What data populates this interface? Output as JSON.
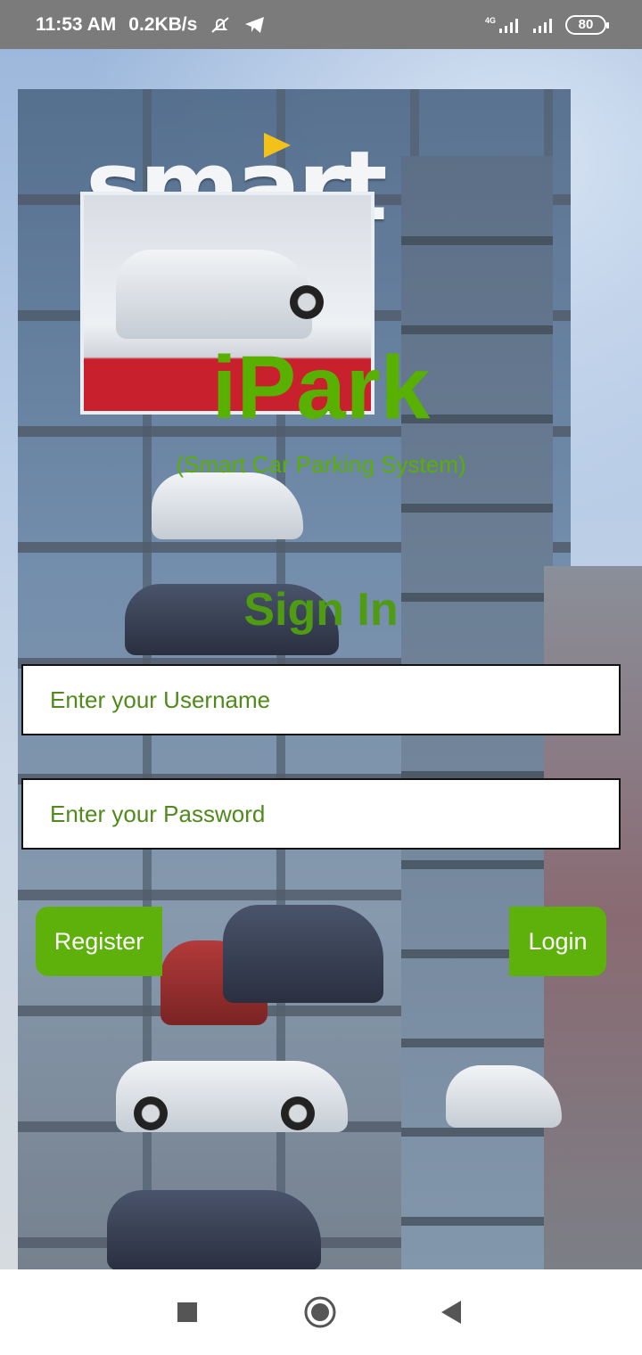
{
  "status_bar": {
    "time": "11:53 AM",
    "network_speed": "0.2KB/s",
    "network_type": "4G",
    "battery": "80",
    "icons": [
      "mute-alarm-icon",
      "telegram-icon",
      "signal-icon",
      "signal-icon",
      "battery-icon"
    ]
  },
  "app": {
    "title": "iPark",
    "subtitle": "(Smart Car Parking System)",
    "heading": "Sign In"
  },
  "form": {
    "username_placeholder": "Enter your Username",
    "username_value": "",
    "password_placeholder": "Enter your Password",
    "password_value": ""
  },
  "buttons": {
    "register": "Register",
    "login": "Login"
  },
  "background": {
    "brand_text": "smart"
  },
  "nav_bar": {
    "icons": [
      "recents-icon",
      "home-icon",
      "back-icon"
    ]
  },
  "colors": {
    "accent": "#5eb10a",
    "title": "#58b000",
    "heading": "#4f9c12",
    "status_bar": "#7b7b7b"
  }
}
